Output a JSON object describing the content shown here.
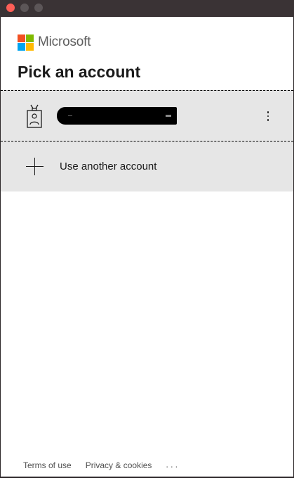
{
  "brand": {
    "name": "Microsoft"
  },
  "page": {
    "title": "Pick an account"
  },
  "accounts": [
    {
      "name_redacted": true,
      "icon": "badge-icon",
      "more_icon": "more-vertical-icon"
    }
  ],
  "use_another": {
    "label": "Use another account",
    "icon": "plus-icon"
  },
  "footer": {
    "terms": "Terms of use",
    "privacy": "Privacy & cookies",
    "more": "..."
  },
  "colors": {
    "logo_red": "#f25022",
    "logo_green": "#7fba00",
    "logo_blue": "#00a4ef",
    "logo_yellow": "#ffb900",
    "row_bg": "#e6e6e6"
  }
}
